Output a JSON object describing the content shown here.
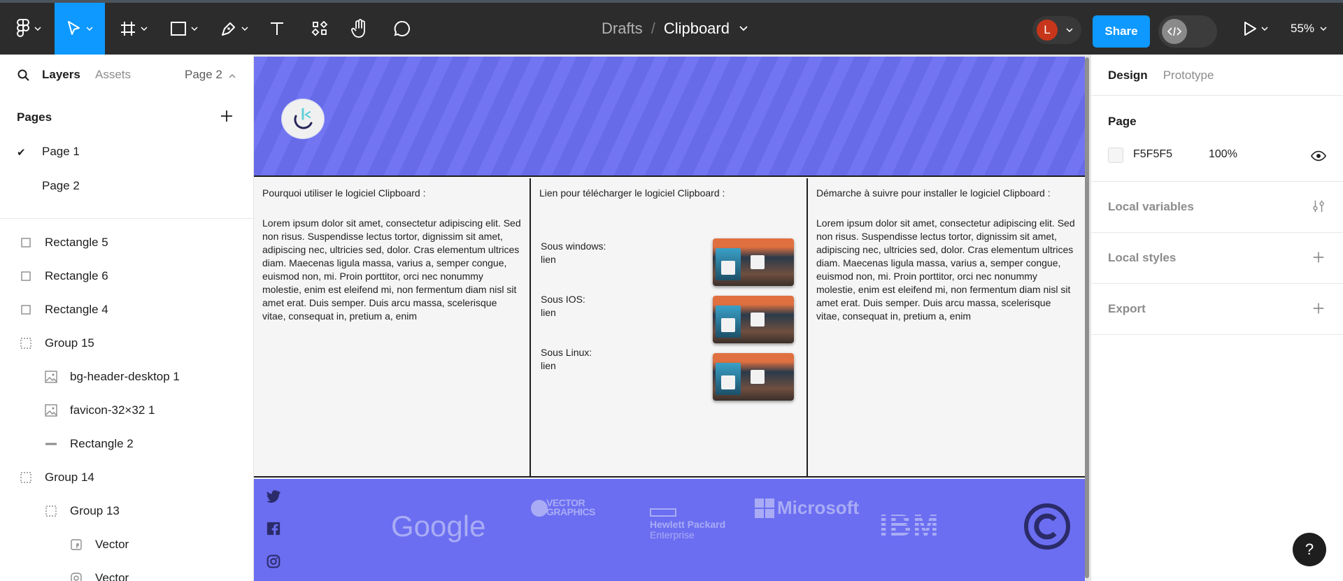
{
  "toolbar": {
    "breadcrumb_project": "Drafts",
    "breadcrumb_sep": "/",
    "file_name": "Clipboard",
    "avatar_initial": "L",
    "share_label": "Share",
    "zoom_level": "55%"
  },
  "left_panel": {
    "tab_layers": "Layers",
    "tab_assets": "Assets",
    "current_page": "Page 2",
    "pages_heading": "Pages",
    "pages": [
      "Page 1",
      "Page 2"
    ],
    "selected_page_index": 1,
    "layers": [
      {
        "name": "Rectangle 5",
        "type": "rectangle",
        "depth": 0
      },
      {
        "name": "Rectangle 6",
        "type": "rectangle",
        "depth": 0
      },
      {
        "name": "Rectangle 4",
        "type": "rectangle",
        "depth": 0
      },
      {
        "name": "Group 15",
        "type": "group",
        "depth": 0
      },
      {
        "name": "bg-header-desktop 1",
        "type": "image",
        "depth": 1
      },
      {
        "name": "favicon-32×32 1",
        "type": "image",
        "depth": 1
      },
      {
        "name": "Rectangle 2",
        "type": "line",
        "depth": 1
      },
      {
        "name": "Group 14",
        "type": "group",
        "depth": 0
      },
      {
        "name": "Group 13",
        "type": "group",
        "depth": 1
      },
      {
        "name": "Vector",
        "type": "vector",
        "depth": 2
      },
      {
        "name": "Vector",
        "type": "vector",
        "depth": 2
      }
    ]
  },
  "canvas": {
    "col1": {
      "title": "Pourquoi utiliser le logiciel Clipboard :",
      "body": "Lorem ipsum dolor sit amet, consectetur adipiscing elit. Sed non risus. Suspendisse lectus tortor, dignissim sit amet, adipiscing nec, ultricies sed, dolor. Cras elementum ultrices diam. Maecenas ligula massa, varius a, semper congue, euismod non, mi. Proin porttitor, orci nec nonummy molestie, enim est eleifend mi, non fermentum diam nisl sit amet erat. Duis semper. Duis arcu massa, scelerisque vitae, consequat in, pretium a, enim"
    },
    "col2": {
      "title": "Lien pour télécharger le logiciel Clipboard :",
      "rows": [
        {
          "os": "Sous windows:",
          "link": "lien"
        },
        {
          "os": "Sous IOS:",
          "link": "lien"
        },
        {
          "os": "Sous Linux:",
          "link": "lien"
        }
      ]
    },
    "col3": {
      "title": "Démarche à suivre pour installer le logiciel Clipboard :",
      "body": "Lorem ipsum dolor sit amet, consectetur adipiscing elit. Sed non risus. Suspendisse lectus tortor, dignissim sit amet, adipiscing nec, ultricies sed, dolor. Cras elementum ultrices diam. Maecenas ligula massa, varius a, semper congue, euismod non, mi. Proin porttitor, orci nec nonummy molestie, enim est eleifend mi, non fermentum diam nisl sit amet erat. Duis semper. Duis arcu massa, scelerisque vitae, consequat in, pretium a, enim"
    },
    "brands": {
      "google": "Google",
      "vector": "VECTOR GRAPHICS",
      "hp_line1": "Hewlett Packard",
      "hp_line2": "Enterprise",
      "microsoft": "Microsoft",
      "ibm": "IBM"
    },
    "colors": {
      "frame_accent": "#6b6ef0",
      "frame_bg": "#f5f5f5"
    }
  },
  "right_panel": {
    "tab_design": "Design",
    "tab_prototype": "Prototype",
    "page_heading": "Page",
    "page_color_hex": "F5F5F5",
    "page_opacity": "100%",
    "local_variables": "Local variables",
    "local_styles": "Local styles",
    "export": "Export"
  },
  "help_label": "?"
}
